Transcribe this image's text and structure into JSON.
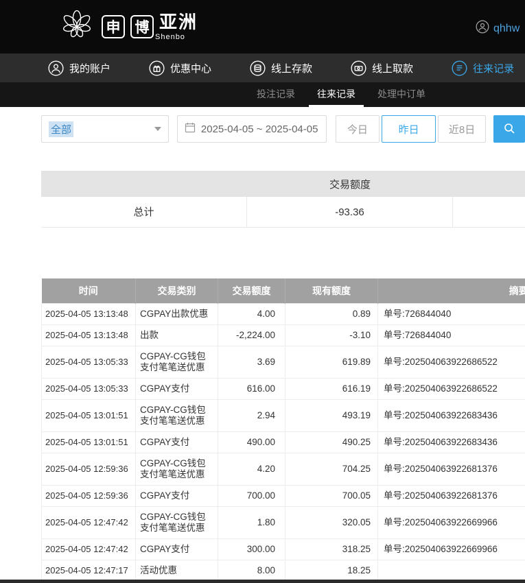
{
  "header": {
    "logo": {
      "flower_icon": "lotus-flower-icon",
      "box_chars": [
        "申",
        "博"
      ],
      "brand_cn": "亚洲",
      "brand_en": "Shenbo"
    },
    "user": {
      "name": "qhhw",
      "icon": "user-avatar-icon"
    }
  },
  "nav": {
    "items": [
      {
        "label": "我的账户",
        "icon": "account-icon",
        "active": false
      },
      {
        "label": "优惠中心",
        "icon": "promotions-icon",
        "active": false
      },
      {
        "label": "线上存款",
        "icon": "deposit-icon",
        "active": false
      },
      {
        "label": "线上取款",
        "icon": "withdraw-icon",
        "active": false
      },
      {
        "label": "往来记录",
        "icon": "records-icon",
        "active": true
      }
    ]
  },
  "subnav": {
    "items": [
      {
        "label": "投注记录",
        "active": false
      },
      {
        "label": "往来记录",
        "active": true
      },
      {
        "label": "处理中订单",
        "active": false
      }
    ]
  },
  "filters": {
    "type_select": {
      "value": "全部",
      "icon": "caret-down-icon"
    },
    "date_range": {
      "value": "2025-04-05 ~ 2025-04-05",
      "icon": "calendar-icon"
    },
    "quick_ranges": [
      {
        "label": "今日",
        "active": false
      },
      {
        "label": "昨日",
        "active": true
      },
      {
        "label": "近8日",
        "active": false
      }
    ],
    "search_button": {
      "icon": "search-icon"
    }
  },
  "summary": {
    "header": "交易额度",
    "total_label": "总计",
    "total_value": "-93.36"
  },
  "table": {
    "columns": [
      "时间",
      "交易类别",
      "交易额度",
      "现有额度",
      "摘要"
    ],
    "rows": [
      [
        "2025-04-05 13:13:48",
        "CGPAY出款优惠",
        "4.00",
        "0.89",
        "单号:726844040"
      ],
      [
        "2025-04-05 13:13:48",
        "出款",
        "-2,224.00",
        "-3.10",
        "单号:726844040"
      ],
      [
        "2025-04-05 13:05:33",
        "CGPAY-CG钱包支付笔笔送优惠",
        "3.69",
        "619.89",
        "单号:202504063922686522"
      ],
      [
        "2025-04-05 13:05:33",
        "CGPAY支付",
        "616.00",
        "616.19",
        "单号:202504063922686522"
      ],
      [
        "2025-04-05 13:01:51",
        "CGPAY-CG钱包支付笔笔送优惠",
        "2.94",
        "493.19",
        "单号:202504063922683436"
      ],
      [
        "2025-04-05 13:01:51",
        "CGPAY支付",
        "490.00",
        "490.25",
        "单号:202504063922683436"
      ],
      [
        "2025-04-05 12:59:36",
        "CGPAY-CG钱包支付笔笔送优惠",
        "4.20",
        "704.25",
        "单号:202504063922681376"
      ],
      [
        "2025-04-05 12:59:36",
        "CGPAY支付",
        "700.00",
        "700.05",
        "单号:202504063922681376"
      ],
      [
        "2025-04-05 12:47:42",
        "CGPAY-CG钱包支付笔笔送优惠",
        "1.80",
        "320.05",
        "单号:202504063922669966"
      ],
      [
        "2025-04-05 12:47:42",
        "CGPAY支付",
        "300.00",
        "318.25",
        "单号:202504063922669966"
      ],
      [
        "2025-04-05 12:47:17",
        "活动优惠",
        "8.00",
        "18.25",
        ""
      ]
    ]
  },
  "colors": {
    "accent": "#3aa7e8",
    "top_header_bg": "#0a0a0a",
    "nav_bg": "#2d2d2d",
    "subnav_bg": "#161616",
    "table_header_bg": "#a1a1a1",
    "summary_header_bg": "#e4e4e4",
    "select_highlight_bg": "#cfe2f3",
    "select_highlight_text": "#3a87c8"
  }
}
